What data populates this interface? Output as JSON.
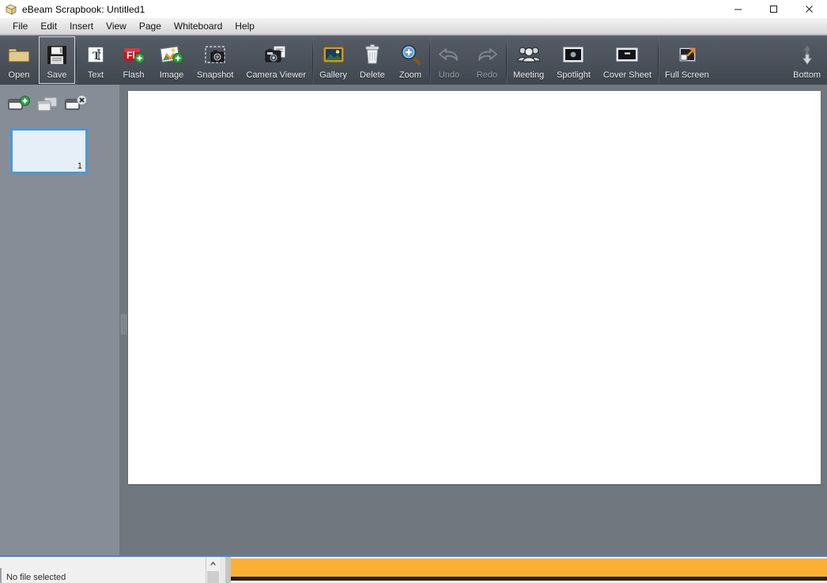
{
  "window": {
    "title": "eBeam Scrapbook: Untitled1",
    "app_icon": "scrapbook-icon",
    "controls": {
      "minimize": "—",
      "maximize": "☐",
      "close": "✕"
    }
  },
  "menubar": {
    "items": [
      {
        "label": "File"
      },
      {
        "label": "Edit"
      },
      {
        "label": "Insert"
      },
      {
        "label": "View"
      },
      {
        "label": "Page"
      },
      {
        "label": "Whiteboard"
      },
      {
        "label": "Help"
      }
    ]
  },
  "toolbar": {
    "groups": [
      {
        "buttons": [
          {
            "label": "Open",
            "icon": "folder-icon",
            "state": "normal"
          },
          {
            "label": "Save",
            "icon": "floppy-disk-icon",
            "state": "active"
          }
        ]
      },
      {
        "buttons": [
          {
            "label": "Text",
            "icon": "text-tool-icon",
            "state": "normal"
          },
          {
            "label": "Flash",
            "icon": "flash-add-icon",
            "state": "normal"
          },
          {
            "label": "Image",
            "icon": "image-add-icon",
            "state": "normal"
          },
          {
            "label": "Snapshot",
            "icon": "snapshot-icon",
            "state": "normal"
          },
          {
            "label": "Camera Viewer",
            "icon": "camera-viewer-icon",
            "state": "normal"
          }
        ]
      },
      {
        "buttons": [
          {
            "label": "Gallery",
            "icon": "gallery-frame-icon",
            "state": "normal"
          },
          {
            "label": "Delete",
            "icon": "trash-icon",
            "state": "normal"
          },
          {
            "label": "Zoom",
            "icon": "magnifier-plus-icon",
            "state": "normal"
          }
        ]
      },
      {
        "buttons": [
          {
            "label": "Undo",
            "icon": "undo-arrow-icon",
            "state": "disabled"
          },
          {
            "label": "Redo",
            "icon": "redo-arrow-icon",
            "state": "disabled"
          }
        ]
      },
      {
        "buttons": [
          {
            "label": "Meeting",
            "icon": "people-group-icon",
            "state": "normal"
          },
          {
            "label": "Spotlight",
            "icon": "spotlight-icon",
            "state": "normal"
          },
          {
            "label": "Cover Sheet",
            "icon": "cover-sheet-icon",
            "state": "normal"
          }
        ]
      },
      {
        "buttons": [
          {
            "label": "Full Screen",
            "icon": "full-screen-icon",
            "state": "normal"
          }
        ]
      },
      {
        "buttons": [
          {
            "label": "Bottom",
            "icon": "up-down-arrows-icon",
            "state": "normal"
          }
        ]
      }
    ]
  },
  "sidebar": {
    "page_tools": [
      {
        "name": "new-page-button",
        "icon": "page-add-icon"
      },
      {
        "name": "duplicate-page-button",
        "icon": "page-copy-icon"
      },
      {
        "name": "delete-page-button",
        "icon": "page-delete-icon"
      }
    ],
    "pages": [
      {
        "number": "1",
        "selected": true
      }
    ]
  },
  "canvas": {
    "background_color": "#ffffff",
    "workarea_color": "#70777f"
  },
  "bottom_dock": {
    "status_text": "No file selected",
    "scroll_up_glyph": "▲",
    "accent_color": "#fbb033"
  },
  "colors": {
    "toolbar_top": "#5c636c",
    "toolbar_bottom": "#3f464e",
    "sidebar": "#868d97",
    "workarea": "#70777f",
    "thumb_border": "#4a9ad4",
    "thumb_fill": "#e6eef8",
    "dock_border": "#4a86c5"
  }
}
